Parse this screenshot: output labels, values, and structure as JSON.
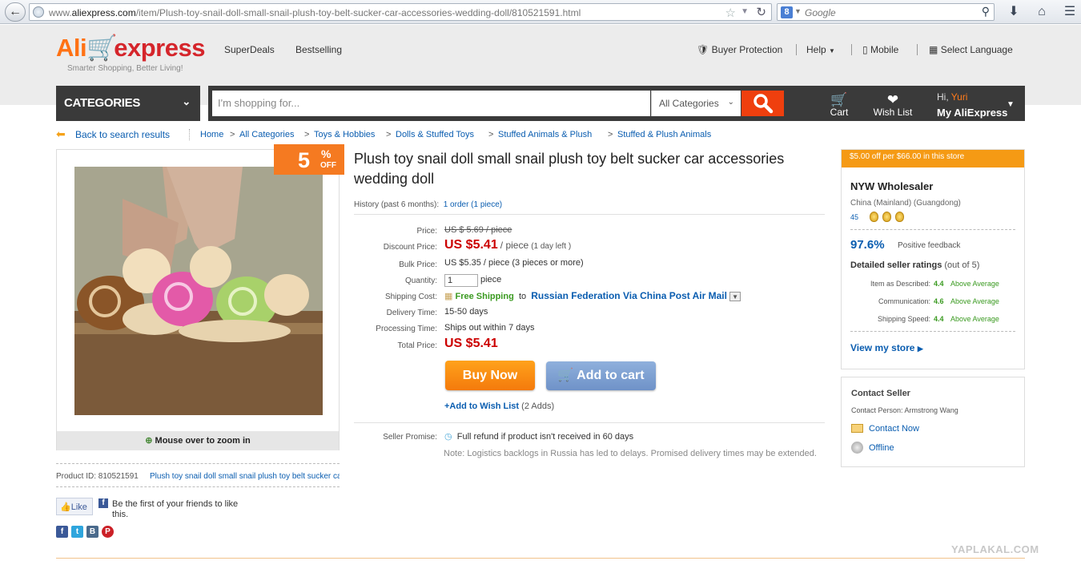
{
  "browser": {
    "url_prefix": "www.",
    "url_domain": "aliexpress.com",
    "url_path": "/item/Plush-toy-snail-doll-small-snail-plush-toy-belt-sucker-car-accessories-wedding-doll/810521591.html",
    "search_engine_letter": "8",
    "search_placeholder": "Google"
  },
  "header": {
    "logo_ali": "Ali",
    "logo_express": "express",
    "tagline": "Smarter Shopping, Better Living!",
    "nav": [
      "SuperDeals",
      "Bestselling"
    ],
    "buyer_protection": "Buyer Protection",
    "help": "Help",
    "mobile": "Mobile",
    "select_language": "Select Language",
    "categories": "CATEGORIES",
    "search_placeholder": "I'm shopping for...",
    "all_categories": "All Categories",
    "cart": "Cart",
    "wish_list": "Wish List",
    "greeting_hi": "Hi, ",
    "user_name": "Yuri",
    "my_aliexpress": "My AliExpress"
  },
  "breadcrumb": {
    "back": "Back to search results",
    "items": [
      "Home",
      "All Categories",
      "Toys & Hobbies",
      "Dolls & Stuffed Toys",
      "Stuffed Animals & Plush",
      "Stuffed & Plush Animals"
    ],
    "separator": ">"
  },
  "image_panel": {
    "discount_number": "5",
    "discount_percent": "%",
    "discount_off": "OFF",
    "zoom_text": "Mouse over to zoom in"
  },
  "product": {
    "title": "Plush toy snail doll small snail plush toy belt sucker car accessories wedding doll",
    "history_label": "History (past 6 months):",
    "history_value": "1 order (1 piece)",
    "price_label": "Price:",
    "price_value": "US $ 5.69 / piece",
    "discount_label": "Discount Price:",
    "discount_value": "US $5.41",
    "discount_unit": "/ piece",
    "discount_days": "(1 day left )",
    "bulk_label": "Bulk Price:",
    "bulk_value": "US $5.35 / piece (3 pieces or more)",
    "quantity_label": "Quantity:",
    "quantity_value": "1",
    "quantity_unit": "piece",
    "shipping_label": "Shipping Cost:",
    "shipping_free": "Free Shipping",
    "shipping_to": "to",
    "shipping_dest": "Russian Federation Via China Post Air Mail",
    "delivery_label": "Delivery Time:",
    "delivery_value": "15-50 days",
    "processing_label": "Processing Time:",
    "processing_value": "Ships out within 7 days",
    "total_label": "Total Price:",
    "total_value": "US $5.41",
    "buy_now": "Buy Now",
    "add_to_cart": "Add to cart",
    "wish_link": "+Add to Wish List",
    "wish_count": "(2 Adds)",
    "promise_label": "Seller Promise:",
    "promise_value": "Full refund if product isn't received in 60 days",
    "note": "Note: Logistics backlogs in Russia has led to delays. Promised delivery times may be extended.",
    "product_id_label": "Product ID: 810521591",
    "product_id_link": "Plush toy snail doll small snail plush toy belt sucker car accessories wedding doll"
  },
  "social": {
    "like": "Like",
    "fb_text": "Be the first of your friends to like this."
  },
  "seller": {
    "promo": "$5.00 off per $66.00 in this store",
    "name": "NYW Wholesaler",
    "location": "China (Mainland) (Guangdong)",
    "score": "45",
    "positive_pct": "97.6%",
    "positive_label": "Positive feedback",
    "ratings_title": "Detailed seller ratings",
    "ratings_out_of": "(out of 5)",
    "ratings": [
      {
        "label": "Item as Described:",
        "value": "4.4",
        "text": "Above Average"
      },
      {
        "label": "Communication:",
        "value": "4.6",
        "text": "Above Average"
      },
      {
        "label": "Shipping Speed:",
        "value": "4.4",
        "text": "Above Average"
      }
    ],
    "view_store": "View my store"
  },
  "contact": {
    "title": "Contact Seller",
    "person": "Contact Person: Armstrong Wang",
    "contact_now": "Contact Now",
    "status": "Offline"
  },
  "watermark": "YAPLAKAL.COM"
}
